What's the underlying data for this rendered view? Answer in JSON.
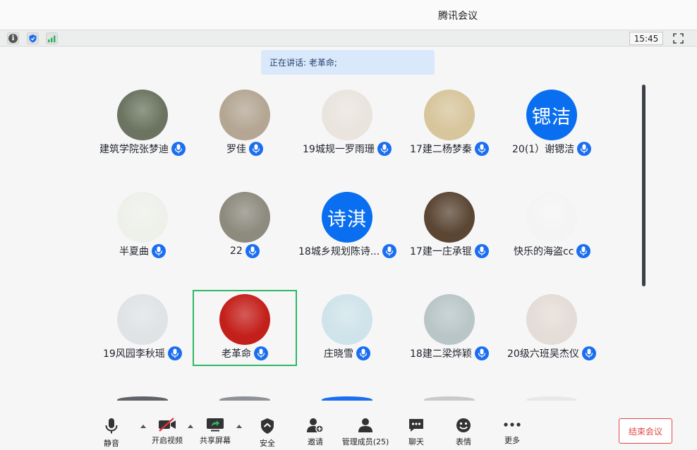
{
  "window": {
    "title": "腾讯会议"
  },
  "top_toolbar": {
    "clock": "15:45"
  },
  "speaking_banner": "正在讲话: 老革命;",
  "participants": [
    {
      "name": "建筑学院张梦迪",
      "avatar_type": "photo",
      "avatar_color": "#6b7460"
    },
    {
      "name": "罗佳",
      "avatar_type": "photo",
      "avatar_color": "#b4a693"
    },
    {
      "name": "19城规一罗雨珊",
      "avatar_type": "photo",
      "avatar_color": "#e9e4dd"
    },
    {
      "name": "17建二杨梦秦",
      "avatar_type": "photo",
      "avatar_color": "#d7c59c"
    },
    {
      "name": "20(1）谢锶洁",
      "avatar_type": "text",
      "avatar_text": "锶洁"
    },
    {
      "name": "半夏曲",
      "avatar_type": "photo",
      "avatar_color": "#eef0ea"
    },
    {
      "name": "22",
      "avatar_type": "photo",
      "avatar_color": "#8d8b7e"
    },
    {
      "name": "18城乡规划陈诗...",
      "avatar_type": "text",
      "avatar_text": "诗淇"
    },
    {
      "name": "17建一庄承锟",
      "avatar_type": "photo",
      "avatar_color": "#5b4634"
    },
    {
      "name": "快乐的海盗cc",
      "avatar_type": "photo",
      "avatar_color": "#f4f4f4"
    },
    {
      "name": "19风园李秋瑶",
      "avatar_type": "photo",
      "avatar_color": "#dfe3e6"
    },
    {
      "name": "老革命",
      "avatar_type": "photo",
      "avatar_color": "#c4201b"
    },
    {
      "name": "庄晓雪",
      "avatar_type": "photo",
      "avatar_color": "#cfe3ea"
    },
    {
      "name": "18建二梁烨颖",
      "avatar_type": "photo",
      "avatar_color": "#b9c6c8"
    },
    {
      "name": "20级六班吴杰仪",
      "avatar_type": "photo",
      "avatar_color": "#e4dcd6"
    }
  ],
  "bottom_toolbar": {
    "mute": "静音",
    "video": "开启视频",
    "share": "共享屏幕",
    "security": "安全",
    "invite": "邀请",
    "members": "管理成员(25)",
    "chat": "聊天",
    "reactions": "表情",
    "more": "更多",
    "end": "结束会议"
  },
  "colors": {
    "accent": "#1a6ef0",
    "active_border": "#2fb765",
    "end": "#e04848",
    "banner": "#d9e8fb"
  }
}
